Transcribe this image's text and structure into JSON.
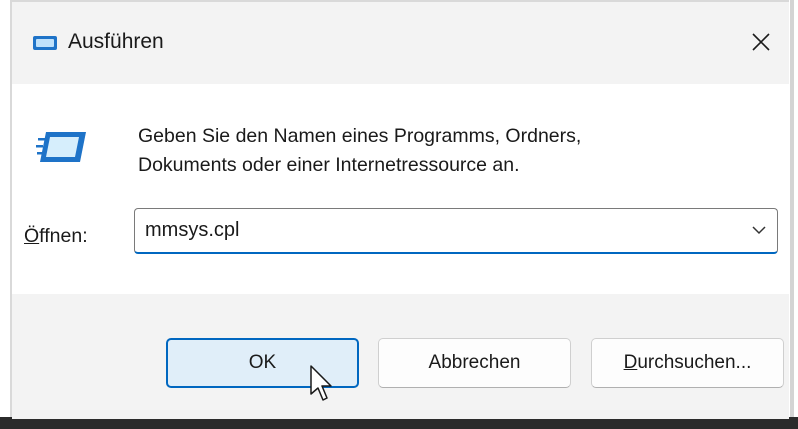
{
  "window": {
    "title": "Ausführen",
    "close_icon": "close-icon",
    "title_icon": "run-icon"
  },
  "content": {
    "description_line1": "Geben Sie den Namen eines Programms, Ordners,",
    "description_line2": "Dokuments oder einer Internetressource an.",
    "open_label_first": "Ö",
    "open_label_rest": "ffnen:",
    "open_value": "mmsys.cpl"
  },
  "buttons": {
    "ok": "OK",
    "cancel": "Abbrechen",
    "browse_first": "D",
    "browse_rest": "urchsuchen..."
  },
  "colors": {
    "accent": "#0067c0",
    "ok_fill": "#e0eef9",
    "chrome": "#f3f3f3"
  }
}
